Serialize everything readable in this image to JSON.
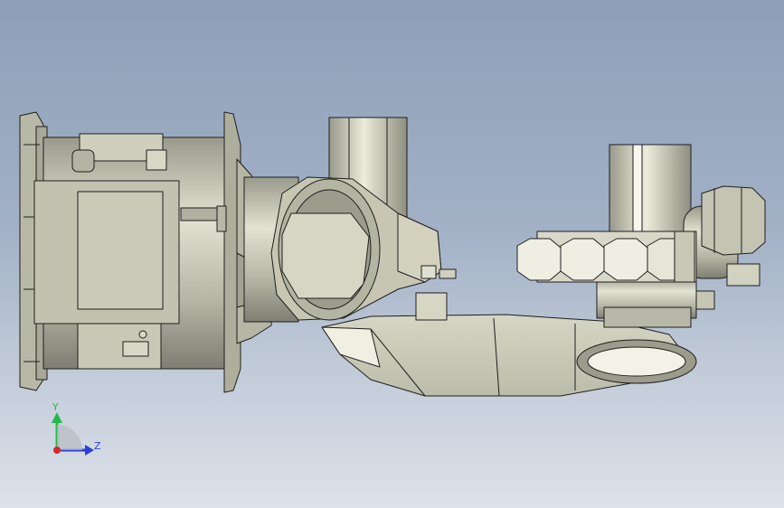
{
  "viewport": {
    "background_top": "#8d9fb8",
    "background_bottom": "#dde2ea"
  },
  "model": {
    "face_color": "#c8c8b4",
    "face_light": "#e8e8d6",
    "face_shadow": "#8a8a7a",
    "edge_color": "#1e1e1e"
  },
  "triad": {
    "y_label": "Y",
    "z_label": "Z",
    "y_axis_color": "#27b84a",
    "z_axis_color": "#2a3fd6",
    "x_axis_color": "#d62a2a"
  }
}
